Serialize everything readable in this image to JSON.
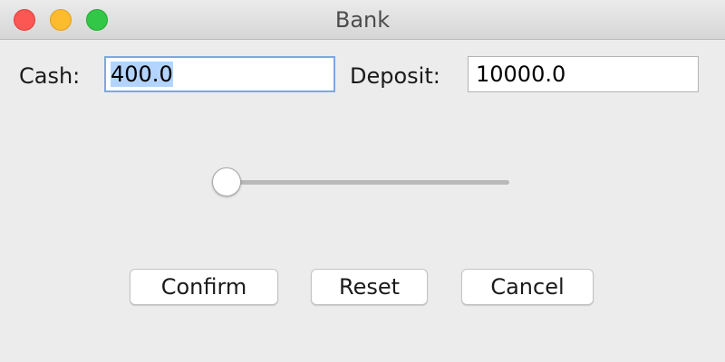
{
  "window": {
    "title": "Bank"
  },
  "form": {
    "cash_label": "Cash:",
    "cash_value": "400.0",
    "deposit_label": "Deposit:",
    "deposit_value": "10000.0"
  },
  "slider": {
    "value_fraction": 0.0
  },
  "buttons": {
    "confirm": "Confirm",
    "reset": "Reset",
    "cancel": "Cancel"
  },
  "colors": {
    "close": "#fc5753",
    "minimize": "#fdbc2e",
    "zoom": "#33c748",
    "selection": "#b3d4fe",
    "focus_ring": "#7fa7dd"
  }
}
